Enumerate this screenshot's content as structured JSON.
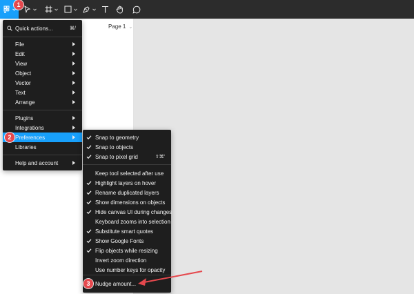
{
  "toolbar": {
    "badge": "1",
    "tools": [
      {
        "icon": "figma-menu-icon"
      },
      {
        "icon": "move-arrow-icon"
      },
      {
        "icon": "frame-hash-icon"
      },
      {
        "icon": "rectangle-icon"
      },
      {
        "icon": "pen-tool-icon"
      },
      {
        "icon": "text-tool-icon"
      },
      {
        "icon": "hand-tool-icon"
      },
      {
        "icon": "comment-icon"
      }
    ]
  },
  "left_panel": {
    "page": "Page 1"
  },
  "main_menu": {
    "quick_actions": {
      "label": "Quick actions...",
      "shortcut": "⌘/"
    },
    "items": [
      {
        "label": "File"
      },
      {
        "label": "Edit"
      },
      {
        "label": "View"
      },
      {
        "label": "Object"
      },
      {
        "label": "Vector"
      },
      {
        "label": "Text"
      },
      {
        "label": "Arrange"
      },
      {
        "label": "Plugins"
      },
      {
        "label": "Integrations"
      },
      {
        "label": "Preferences"
      },
      {
        "label": "Libraries"
      },
      {
        "label": "Help and account"
      }
    ],
    "badge": "2"
  },
  "preferences_menu": {
    "items": [
      {
        "label": "Snap to geometry",
        "checked": true
      },
      {
        "label": "Snap to objects",
        "checked": true
      },
      {
        "label": "Snap to pixel grid",
        "checked": true,
        "shortcut": "⇧⌘'"
      },
      {
        "label": "Keep tool selected after use",
        "checked": false
      },
      {
        "label": "Highlight layers on hover",
        "checked": true
      },
      {
        "label": "Rename duplicated layers",
        "checked": true
      },
      {
        "label": "Show dimensions on objects",
        "checked": true
      },
      {
        "label": "Hide canvas UI during changes",
        "checked": true
      },
      {
        "label": "Keyboard zooms into selection",
        "checked": false
      },
      {
        "label": "Substitute smart quotes",
        "checked": true
      },
      {
        "label": "Show Google Fonts",
        "checked": true
      },
      {
        "label": "Flip objects while resizing",
        "checked": true
      },
      {
        "label": "Invert zoom direction",
        "checked": false
      },
      {
        "label": "Use number keys for opacity",
        "checked": false
      },
      {
        "label": "Nudge amount...",
        "checked": false
      }
    ],
    "badge": "3"
  },
  "colors": {
    "accent": "#18a0fb",
    "annotation": "#e5484d",
    "menu_bg": "#1e1e1e",
    "toolbar_bg": "#2c2c2c"
  }
}
